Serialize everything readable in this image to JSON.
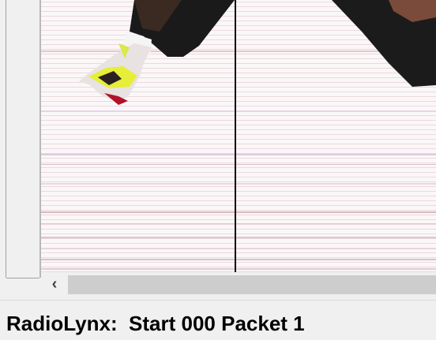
{
  "finish_image": {
    "description_icon": "finish-line-photo"
  },
  "scrollbar": {
    "left_arrow_glyph": "‹"
  },
  "status_bar": {
    "text": "RadioLynx:  Start 000 Packet 1"
  },
  "colors": {
    "background": "#f0f0f0",
    "scroll_thumb": "#cdcdcd",
    "finish_line": "#000000"
  }
}
